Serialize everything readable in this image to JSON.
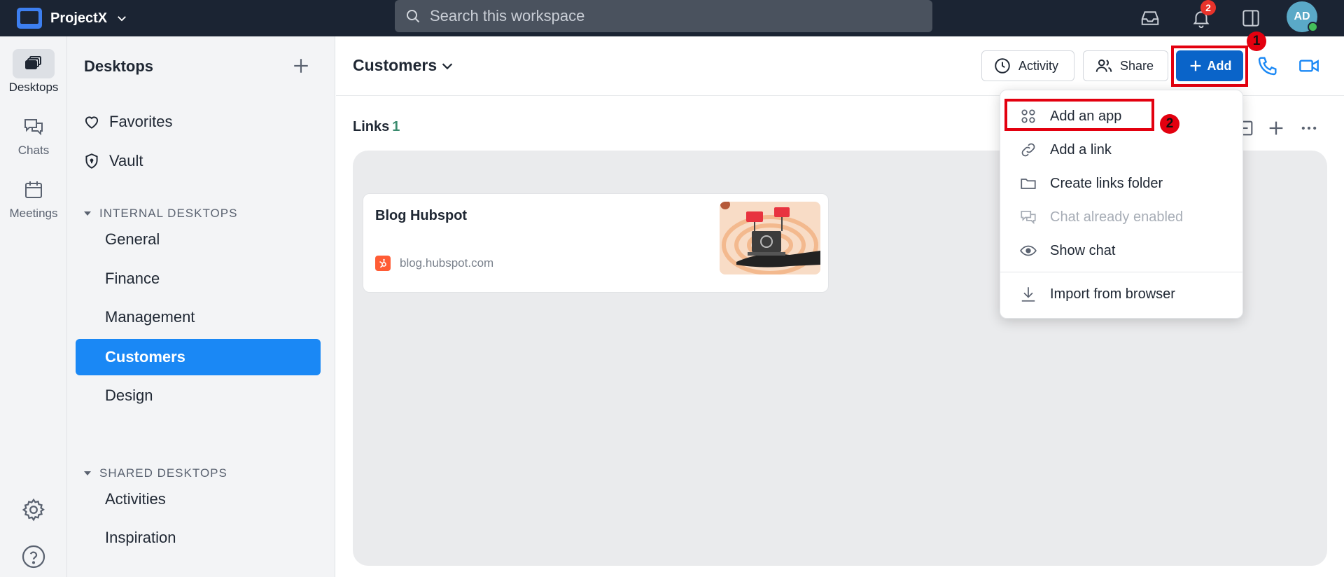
{
  "topbar": {
    "app_name": "ProjectX",
    "search_placeholder": "Search this workspace",
    "notification_count": "2",
    "avatar_initials": "AD"
  },
  "rail": {
    "items": [
      {
        "label": "Desktops",
        "icon": "desktops-icon",
        "active": true
      },
      {
        "label": "Chats",
        "icon": "chat-icon",
        "active": false
      },
      {
        "label": "Meetings",
        "icon": "calendar-icon",
        "active": false
      }
    ],
    "bottom_icons": [
      "gear-icon",
      "help-icon"
    ]
  },
  "sidebar": {
    "title": "Desktops",
    "links": [
      {
        "label": "Favorites",
        "icon": "heart-icon"
      },
      {
        "label": "Vault",
        "icon": "shield-icon"
      }
    ],
    "internal_section": "INTERNAL DESKTOPS",
    "internal_items": [
      "General",
      "Finance",
      "Management",
      "Customers",
      "Design"
    ],
    "active_item": "Customers",
    "shared_section": "SHARED DESKTOPS",
    "shared_items": [
      "Activities",
      "Inspiration"
    ]
  },
  "header": {
    "title": "Customers",
    "activity_label": "Activity",
    "share_label": "Share",
    "add_label": "Add"
  },
  "annotations": {
    "badge_1": "1",
    "badge_2": "2"
  },
  "links": {
    "title": "Links",
    "count": "1",
    "cards": [
      {
        "title": "Blog Hubspot",
        "url": "blog.hubspot.com"
      }
    ]
  },
  "menu": {
    "items": [
      {
        "label": "Add an app",
        "icon": "grid-icon",
        "disabled": false
      },
      {
        "label": "Add a link",
        "icon": "link-icon",
        "disabled": false
      },
      {
        "label": "Create links folder",
        "icon": "folder-icon",
        "disabled": false
      },
      {
        "label": "Chat already enabled",
        "icon": "chat-icon",
        "disabled": true
      },
      {
        "label": "Show chat",
        "icon": "eye-icon",
        "disabled": false
      },
      {
        "label": "Import from browser",
        "icon": "download-icon",
        "disabled": false
      }
    ]
  },
  "colors": {
    "topbar": "#1b2433",
    "primary": "#0a64c9",
    "active_item": "#1a88f5",
    "annotation": "#e3000f",
    "accent_icon": "#1a88f5"
  }
}
